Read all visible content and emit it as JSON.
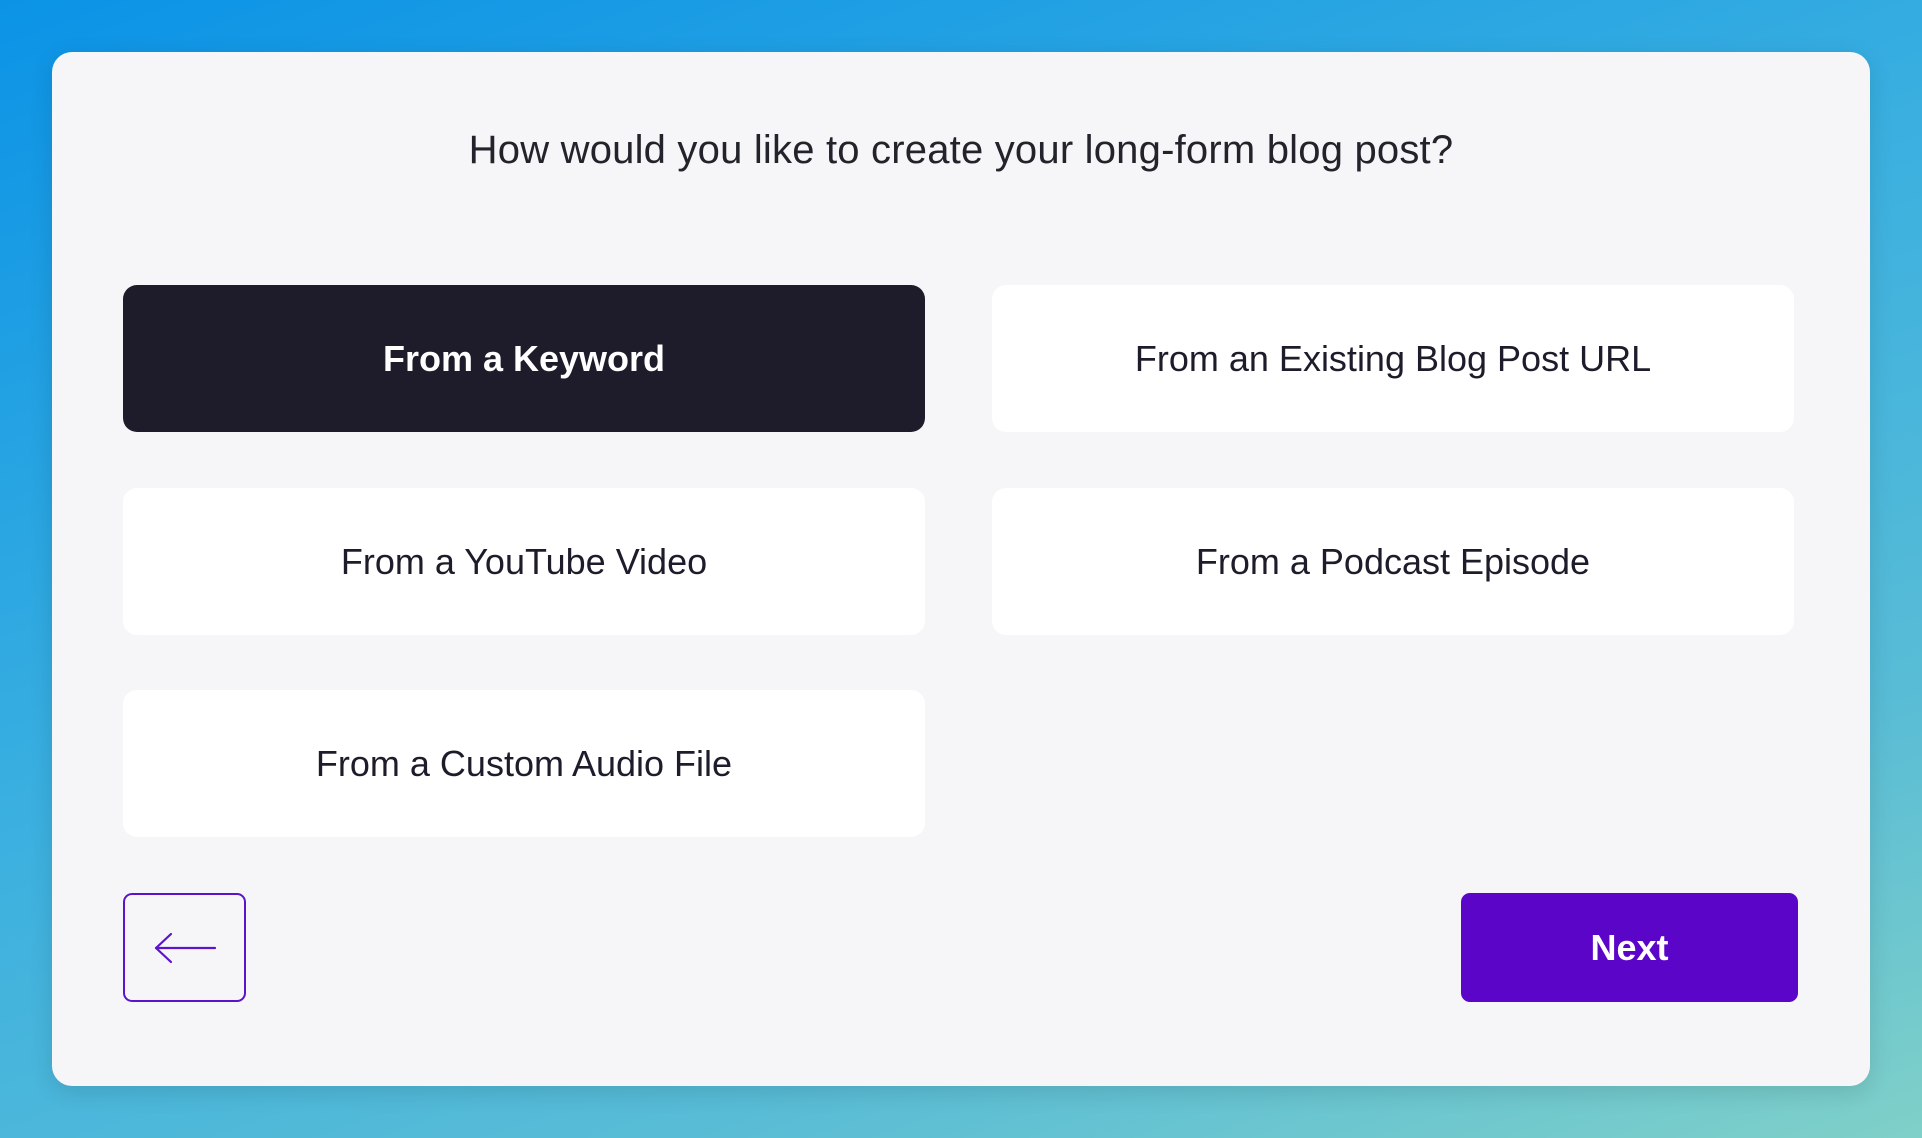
{
  "wizard": {
    "question": "How would you like to create your long-form blog post?",
    "options": [
      {
        "label": "From a Keyword",
        "selected": true
      },
      {
        "label": "From an Existing Blog Post URL",
        "selected": false
      },
      {
        "label": "From a YouTube Video",
        "selected": false
      },
      {
        "label": "From a Podcast Episode",
        "selected": false
      },
      {
        "label": "From a Custom Audio File",
        "selected": false
      }
    ],
    "back_icon": "arrow-left-icon",
    "next_label": "Next"
  },
  "colors": {
    "selected_option_bg": "#1e1c2b",
    "accent": "#5b05c8",
    "card_bg": "#f6f6f8"
  }
}
